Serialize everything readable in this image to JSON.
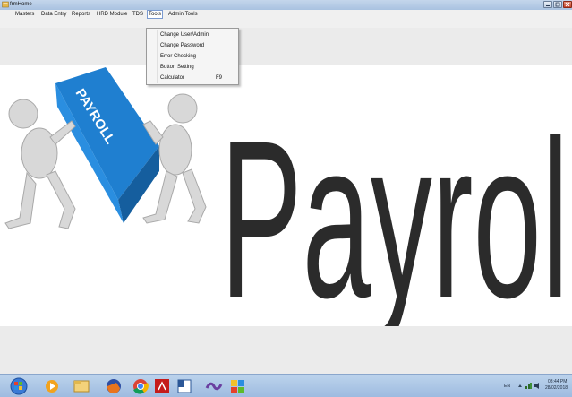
{
  "window": {
    "title": "frmHome",
    "icon": "app-form-icon",
    "buttons": [
      "minimize-icon",
      "maximize-icon",
      "close-icon"
    ]
  },
  "menu": {
    "items": [
      "Masters",
      "Data Entry",
      "Reports",
      "HRD Module",
      "TDS",
      "Tools",
      "Admin Tools"
    ],
    "open_item": "Tools"
  },
  "tools_menu": {
    "items": [
      {
        "label": "Change User/Admin",
        "shortcut": ""
      },
      {
        "label": "Change Password",
        "shortcut": ""
      },
      {
        "label": "Error Checking",
        "shortcut": ""
      },
      {
        "label": "Button Setting",
        "shortcut": ""
      },
      {
        "label": "Calculator",
        "shortcut": "F9"
      }
    ]
  },
  "banner": {
    "word": "Payroll",
    "box_label": "PAYROLL",
    "colors": {
      "box": "#1f7fd0",
      "text": "#2b2b2b"
    }
  },
  "taskbar": {
    "apps": [
      "start-orb-icon",
      "media-player-icon",
      "file-explorer-icon",
      "firefox-icon",
      "chrome-icon",
      "pdf-reader-icon",
      "word-icon",
      "visual-studio-icon",
      "paint-icon"
    ],
    "language": "EN",
    "time": "03:44 PM",
    "date": "28/02/2018"
  }
}
